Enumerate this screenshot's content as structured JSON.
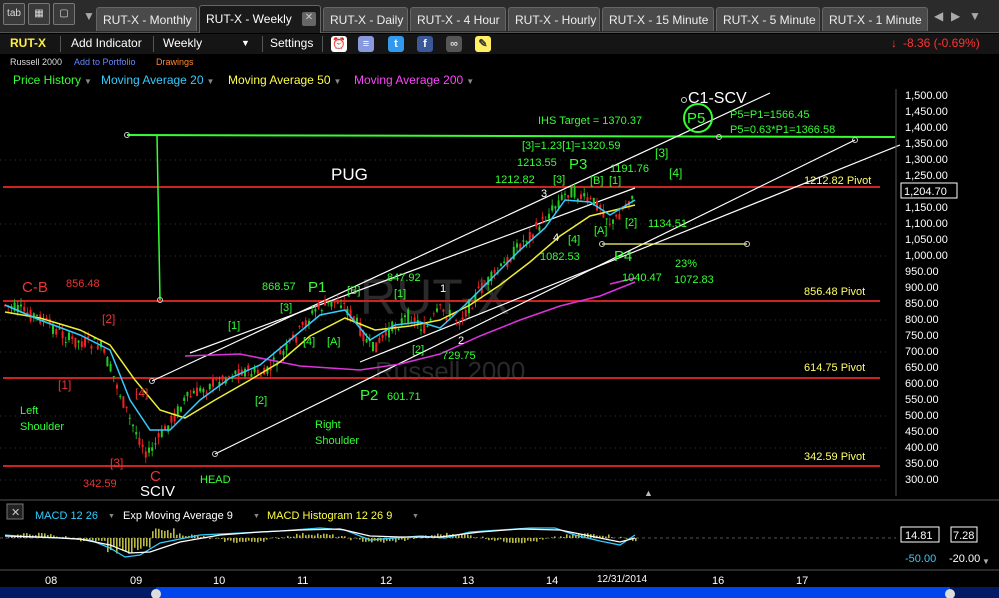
{
  "tabbar": {
    "tab_button": "tab",
    "tabs": [
      {
        "label": "RUT-X - Monthly",
        "active": false
      },
      {
        "label": "RUT-X - Weekly",
        "active": true
      },
      {
        "label": "RUT-X - Daily",
        "active": false
      },
      {
        "label": "RUT-X - 4 Hour",
        "active": false
      },
      {
        "label": "RUT-X - Hourly",
        "active": false
      },
      {
        "label": "RUT-X - 15 Minute",
        "active": false
      },
      {
        "label": "RUT-X - 5 Minute",
        "active": false
      },
      {
        "label": "RUT-X - 1 Minute",
        "active": false
      }
    ],
    "close_glyph": "✕",
    "icons": [
      "grid-icon",
      "window-icon",
      "close-icon",
      "chevron-down-icon",
      "chevron-left-icon",
      "chevron-right-icon"
    ]
  },
  "toolbar": {
    "symbol": "RUT-X",
    "add_indicator": "Add Indicator",
    "timeframe": "Weekly",
    "settings": "Settings",
    "change": "-8.36 (-0.69%)",
    "change_color": "#ff3333"
  },
  "subrow": {
    "name": "Russell 2000",
    "add_portfolio": "Add to Portfolio",
    "drawings": "Drawings"
  },
  "indicators": [
    {
      "label": "Price History",
      "color": "#33ff33"
    },
    {
      "label": "Moving Average 20",
      "color": "#33ccff"
    },
    {
      "label": "Moving Average 50",
      "color": "#ffff44"
    },
    {
      "label": "Moving Average 200",
      "color": "#ff44ff"
    }
  ],
  "price_axis": {
    "ticks": [
      "1,500.00",
      "1,450.00",
      "1,400.00",
      "1,350.00",
      "1,300.00",
      "1,250.00",
      "1,200.00",
      "1,150.00",
      "1,100.00",
      "1,050.00",
      "1,000.00",
      "950.00",
      "900.00",
      "850.00",
      "800.00",
      "750.00",
      "700.00",
      "650.00",
      "600.00",
      "550.00",
      "500.00",
      "450.00",
      "400.00",
      "350.00",
      "300.00"
    ],
    "current": "1,204.70"
  },
  "pivots": [
    {
      "label": "1212.82 Pivot",
      "color": "#ffff66"
    },
    {
      "label": "856.48 Pivot",
      "color": "#ffff66"
    },
    {
      "label": "614.75 Pivot",
      "color": "#ffff66"
    },
    {
      "label": "342.59 Pivot",
      "color": "#ffff66"
    }
  ],
  "watermark": {
    "symbol": "RUT-X",
    "name": "Russell 2000"
  },
  "annotations": {
    "green": [
      "IHS Target = 1370.37",
      "P5=P1=1566.45",
      "P5=0.63*P1=1366.58",
      "[3]=1.23[1]=1320.59",
      "[3]",
      "1213.55",
      "P3",
      "1212.82",
      "[3]",
      "[B]",
      "[1]",
      "1191.76",
      "[4]",
      "1134.51",
      "[A]",
      "[2]",
      "[4]",
      "1082.53",
      "P4",
      "23%",
      "1040.47",
      "1072.83",
      "868.57",
      "P1",
      "[B]",
      "847.92",
      "[3]",
      "[1]",
      "[4]",
      "[A]",
      "[1]",
      "[2]",
      "729.75",
      "P2",
      "601.71",
      "[2]",
      "Left",
      "Shoulder",
      "Right",
      "Shoulder",
      "HEAD",
      "P5"
    ],
    "white": [
      "PUG",
      "C1-SCV",
      "3",
      "4",
      "1",
      "2",
      "SCIV"
    ],
    "red": [
      "C-B",
      "856.48",
      "[2]",
      "[1]",
      "[4]",
      "[3]",
      "342.59",
      "C"
    ]
  },
  "macd": {
    "label1": "MACD 12 26",
    "label2": "Exp Moving Average 9",
    "label3": "MACD Histogram 12 26 9",
    "color1": "#33ccff",
    "color2": "#ffffff",
    "color3": "#ffff44",
    "value1": "14.81",
    "value2": "7.28",
    "tick1": "-50.00",
    "tick2": "-20.00"
  },
  "time_axis": [
    "08",
    "09",
    "10",
    "11",
    "12",
    "13",
    "14",
    "12/31/2014",
    "16",
    "17"
  ]
}
